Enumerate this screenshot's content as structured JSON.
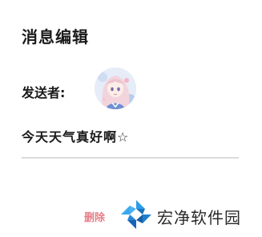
{
  "header": {
    "title": "消息编辑"
  },
  "sender": {
    "label": "发送者:",
    "avatar_icon": "anime-girl-avatar"
  },
  "message": {
    "text": "今天天气真好啊☆"
  },
  "actions": {
    "delete_label": "删除"
  },
  "watermark": {
    "text": "宏净软件园",
    "logo_icon": "pinwheel-logo-icon"
  },
  "colors": {
    "delete_accent": "#e4707a",
    "logo_blue": "#1e88d8",
    "divider": "#bdbdbd"
  }
}
